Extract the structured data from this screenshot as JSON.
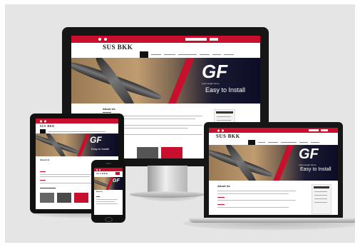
{
  "brand": {
    "logo": "SUS BKK",
    "accent": "#c8102e"
  },
  "hero": {
    "badge": "GF",
    "tagline": "Easy to Install",
    "subline": "Light weight frame"
  },
  "section": {
    "title": "About Us"
  },
  "icons": [
    "dot-icon",
    "dot-icon"
  ]
}
